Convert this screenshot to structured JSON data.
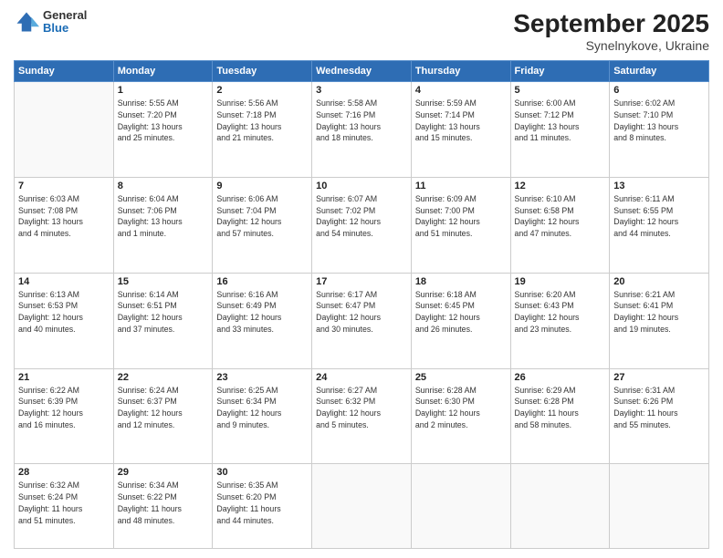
{
  "logo": {
    "general": "General",
    "blue": "Blue"
  },
  "title": "September 2025",
  "subtitle": "Synelnykove, Ukraine",
  "weekdays": [
    "Sunday",
    "Monday",
    "Tuesday",
    "Wednesday",
    "Thursday",
    "Friday",
    "Saturday"
  ],
  "weeks": [
    [
      {
        "day": "",
        "info": ""
      },
      {
        "day": "1",
        "info": "Sunrise: 5:55 AM\nSunset: 7:20 PM\nDaylight: 13 hours\nand 25 minutes."
      },
      {
        "day": "2",
        "info": "Sunrise: 5:56 AM\nSunset: 7:18 PM\nDaylight: 13 hours\nand 21 minutes."
      },
      {
        "day": "3",
        "info": "Sunrise: 5:58 AM\nSunset: 7:16 PM\nDaylight: 13 hours\nand 18 minutes."
      },
      {
        "day": "4",
        "info": "Sunrise: 5:59 AM\nSunset: 7:14 PM\nDaylight: 13 hours\nand 15 minutes."
      },
      {
        "day": "5",
        "info": "Sunrise: 6:00 AM\nSunset: 7:12 PM\nDaylight: 13 hours\nand 11 minutes."
      },
      {
        "day": "6",
        "info": "Sunrise: 6:02 AM\nSunset: 7:10 PM\nDaylight: 13 hours\nand 8 minutes."
      }
    ],
    [
      {
        "day": "7",
        "info": "Sunrise: 6:03 AM\nSunset: 7:08 PM\nDaylight: 13 hours\nand 4 minutes."
      },
      {
        "day": "8",
        "info": "Sunrise: 6:04 AM\nSunset: 7:06 PM\nDaylight: 13 hours\nand 1 minute."
      },
      {
        "day": "9",
        "info": "Sunrise: 6:06 AM\nSunset: 7:04 PM\nDaylight: 12 hours\nand 57 minutes."
      },
      {
        "day": "10",
        "info": "Sunrise: 6:07 AM\nSunset: 7:02 PM\nDaylight: 12 hours\nand 54 minutes."
      },
      {
        "day": "11",
        "info": "Sunrise: 6:09 AM\nSunset: 7:00 PM\nDaylight: 12 hours\nand 51 minutes."
      },
      {
        "day": "12",
        "info": "Sunrise: 6:10 AM\nSunset: 6:58 PM\nDaylight: 12 hours\nand 47 minutes."
      },
      {
        "day": "13",
        "info": "Sunrise: 6:11 AM\nSunset: 6:55 PM\nDaylight: 12 hours\nand 44 minutes."
      }
    ],
    [
      {
        "day": "14",
        "info": "Sunrise: 6:13 AM\nSunset: 6:53 PM\nDaylight: 12 hours\nand 40 minutes."
      },
      {
        "day": "15",
        "info": "Sunrise: 6:14 AM\nSunset: 6:51 PM\nDaylight: 12 hours\nand 37 minutes."
      },
      {
        "day": "16",
        "info": "Sunrise: 6:16 AM\nSunset: 6:49 PM\nDaylight: 12 hours\nand 33 minutes."
      },
      {
        "day": "17",
        "info": "Sunrise: 6:17 AM\nSunset: 6:47 PM\nDaylight: 12 hours\nand 30 minutes."
      },
      {
        "day": "18",
        "info": "Sunrise: 6:18 AM\nSunset: 6:45 PM\nDaylight: 12 hours\nand 26 minutes."
      },
      {
        "day": "19",
        "info": "Sunrise: 6:20 AM\nSunset: 6:43 PM\nDaylight: 12 hours\nand 23 minutes."
      },
      {
        "day": "20",
        "info": "Sunrise: 6:21 AM\nSunset: 6:41 PM\nDaylight: 12 hours\nand 19 minutes."
      }
    ],
    [
      {
        "day": "21",
        "info": "Sunrise: 6:22 AM\nSunset: 6:39 PM\nDaylight: 12 hours\nand 16 minutes."
      },
      {
        "day": "22",
        "info": "Sunrise: 6:24 AM\nSunset: 6:37 PM\nDaylight: 12 hours\nand 12 minutes."
      },
      {
        "day": "23",
        "info": "Sunrise: 6:25 AM\nSunset: 6:34 PM\nDaylight: 12 hours\nand 9 minutes."
      },
      {
        "day": "24",
        "info": "Sunrise: 6:27 AM\nSunset: 6:32 PM\nDaylight: 12 hours\nand 5 minutes."
      },
      {
        "day": "25",
        "info": "Sunrise: 6:28 AM\nSunset: 6:30 PM\nDaylight: 12 hours\nand 2 minutes."
      },
      {
        "day": "26",
        "info": "Sunrise: 6:29 AM\nSunset: 6:28 PM\nDaylight: 11 hours\nand 58 minutes."
      },
      {
        "day": "27",
        "info": "Sunrise: 6:31 AM\nSunset: 6:26 PM\nDaylight: 11 hours\nand 55 minutes."
      }
    ],
    [
      {
        "day": "28",
        "info": "Sunrise: 6:32 AM\nSunset: 6:24 PM\nDaylight: 11 hours\nand 51 minutes."
      },
      {
        "day": "29",
        "info": "Sunrise: 6:34 AM\nSunset: 6:22 PM\nDaylight: 11 hours\nand 48 minutes."
      },
      {
        "day": "30",
        "info": "Sunrise: 6:35 AM\nSunset: 6:20 PM\nDaylight: 11 hours\nand 44 minutes."
      },
      {
        "day": "",
        "info": ""
      },
      {
        "day": "",
        "info": ""
      },
      {
        "day": "",
        "info": ""
      },
      {
        "day": "",
        "info": ""
      }
    ]
  ]
}
